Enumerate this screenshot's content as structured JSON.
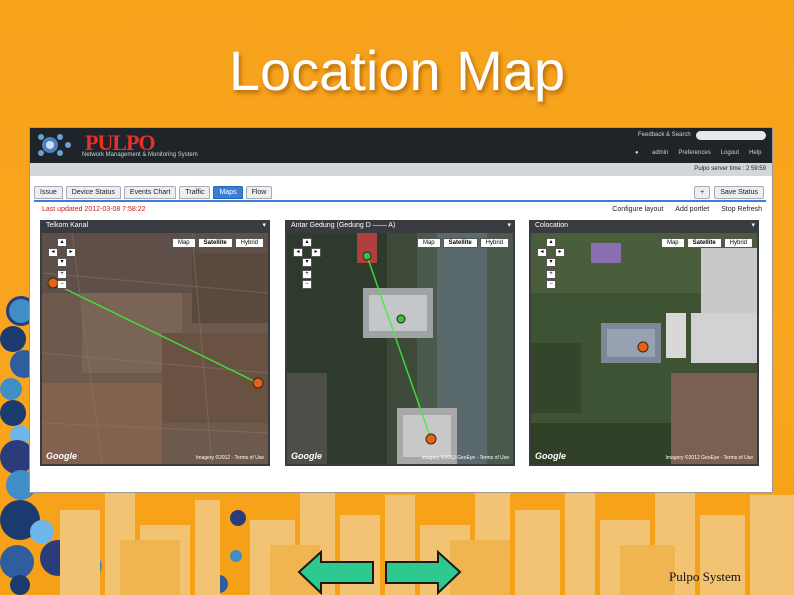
{
  "slide": {
    "title": "Location Map",
    "footer": "Pulpo System",
    "background_color": "#f7a21b",
    "nav_arrow_color": "#2ec98f"
  },
  "app": {
    "brand": "PULPO",
    "subtitle": "Network Management & Monitoring System",
    "feedback_label": "Feedback & Search",
    "user_links": [
      "admin",
      "Preferences",
      "Logout",
      "Help"
    ],
    "server_time": "Pulpo server time : 2 59:59",
    "tabs": [
      {
        "label": "Issue",
        "active": false
      },
      {
        "label": "Device Status",
        "active": false
      },
      {
        "label": "Events Chart",
        "active": false
      },
      {
        "label": "Traffic",
        "active": false
      },
      {
        "label": "Maps",
        "active": true
      },
      {
        "label": "Flow",
        "active": false
      }
    ],
    "right_buttons": [
      "+",
      "Save Status"
    ],
    "last_updated": "Last updated 2012-03-08 7:58:22",
    "top_links": [
      "Configure layout",
      "Add portlet",
      "Stop Refresh"
    ]
  },
  "panels": [
    {
      "title": "Telkom Kanal",
      "map_types": [
        "Map",
        "Satellite",
        "Hybrid"
      ],
      "selected": "Satellite",
      "google": "Google",
      "copyright": "Imagery ©2012 - Terms of Use"
    },
    {
      "title": "Antar Gedung (Gedung D —— A)",
      "map_types": [
        "Map",
        "Satellite",
        "Hybrid"
      ],
      "selected": "Satellite",
      "google": "Google",
      "copyright": "Imagery ©2012 GeoEye - Terms of Use"
    },
    {
      "title": "Colocation",
      "map_types": [
        "Map",
        "Satellite",
        "Hybrid"
      ],
      "selected": "Satellite",
      "google": "Google",
      "copyright": "Imagery ©2012 GeoEye - Terms of Use"
    }
  ]
}
